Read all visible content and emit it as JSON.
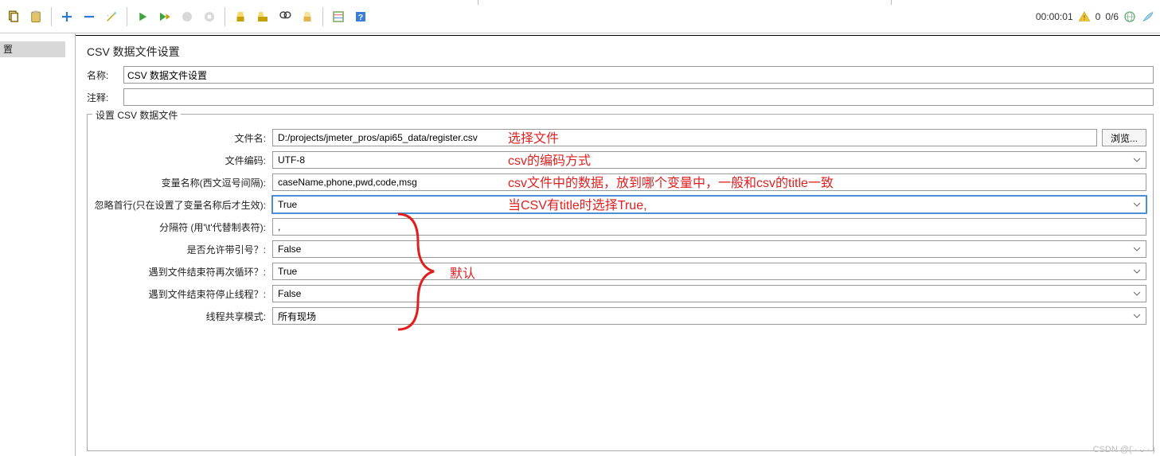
{
  "toolbar": {
    "timer": "00:00:01",
    "warn_count": "0",
    "thread_count": "0/6"
  },
  "left": {
    "selected": "置"
  },
  "panel": {
    "title": "CSV 数据文件设置",
    "name_label": "名称:",
    "name_value": "CSV 数据文件设置",
    "comment_label": "注释:",
    "comment_value": ""
  },
  "fieldset": {
    "legend": "设置 CSV 数据文件",
    "filename_label": "文件名:",
    "filename_value": "D:/projects/jmeter_pros/api65_data/register.csv",
    "browse_label": "浏览...",
    "encoding_label": "文件编码:",
    "encoding_value": "UTF-8",
    "varnames_label": "变量名称(西文逗号间隔):",
    "varnames_value": "caseName,phone,pwd,code,msg",
    "ignore_first_label": "忽略首行(只在设置了变量名称后才生效):",
    "ignore_first_value": "True",
    "delimiter_label": "分隔符 (用'\\t'代替制表符):",
    "delimiter_value": ",",
    "allow_quoted_label": "是否允许带引号？:",
    "allow_quoted_value": "False",
    "recycle_label": "遇到文件结束符再次循环？:",
    "recycle_value": "True",
    "stop_thread_label": "遇到文件结束符停止线程？:",
    "stop_thread_value": "False",
    "share_mode_label": "线程共享模式:",
    "share_mode_value": "所有现场"
  },
  "annotations": {
    "a1": "选择文件",
    "a2": "csv的编码方式",
    "a3": "csv文件中的数据，放到哪个变量中，一般和csv的title一致",
    "a4": "当CSV有title时选择True,",
    "default_label": "默认"
  },
  "watermark": "CSDN @( · ᴗ · )"
}
